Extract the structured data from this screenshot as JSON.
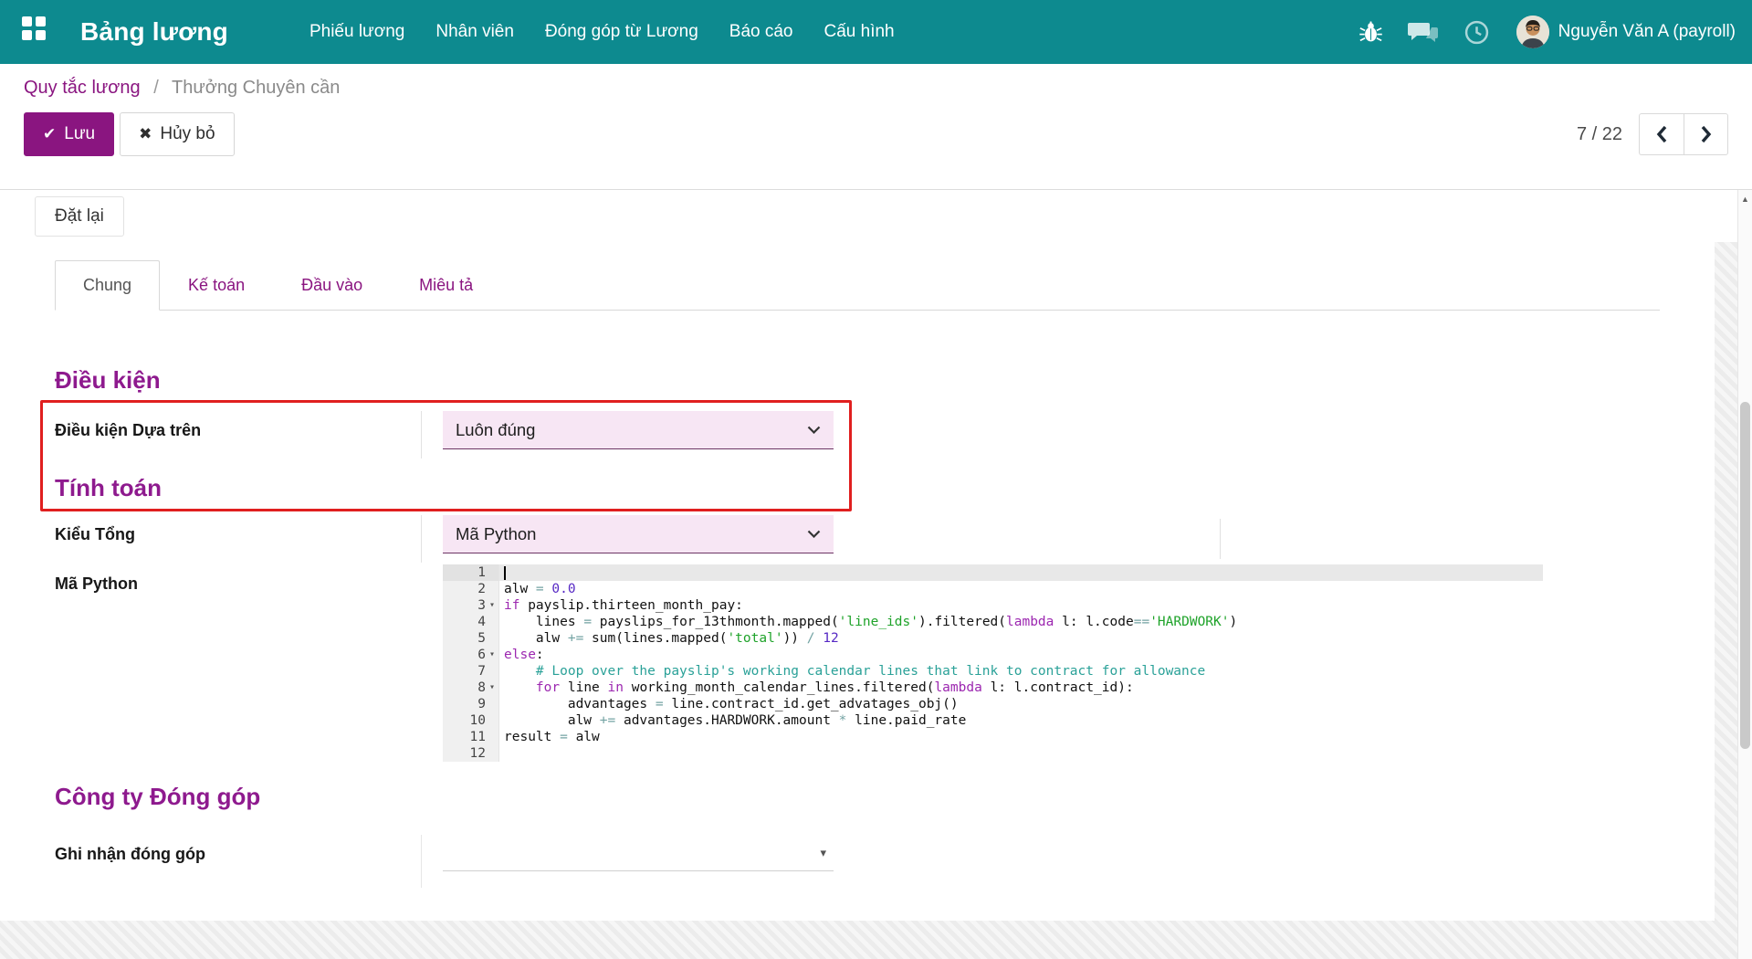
{
  "colors": {
    "navbar_bg": "#0d8a8f",
    "accent_purple": "#8a1580",
    "heading_purple": "#8e1a8e",
    "select_bg": "#f7e6f4",
    "annotation_red": "#e01f1f",
    "code_keyword": "#9c27b0",
    "code_number": "#5628c4",
    "code_string": "#1fa32a",
    "code_comment": "#2aa198",
    "code_operator": "#73a3a3"
  },
  "navbar": {
    "app_title": "Bảng lương",
    "menu_items": [
      {
        "label": "Phiếu lương"
      },
      {
        "label": "Nhân viên"
      },
      {
        "label": "Đóng góp từ Lương"
      },
      {
        "label": "Báo cáo"
      },
      {
        "label": "Cấu hình"
      }
    ],
    "user_name": "Nguyễn Văn A (payroll)"
  },
  "breadcrumb": {
    "parent": "Quy tắc lương",
    "separator": "/",
    "current": "Thưởng Chuyên cần"
  },
  "control_panel": {
    "save_label": "Lưu",
    "discard_label": "Hủy bỏ",
    "pager_value": "7 / 22"
  },
  "statusbar": {
    "reset_label": "Đặt lại"
  },
  "notebook": {
    "tabs": [
      {
        "label": "Chung",
        "active": true
      },
      {
        "label": "Kế toán",
        "active": false
      },
      {
        "label": "Đầu vào",
        "active": false
      },
      {
        "label": "Miêu tả",
        "active": false
      }
    ]
  },
  "form": {
    "condition_section": {
      "title": "Điều kiện",
      "condition_based_on_label": "Điều kiện Dựa trên",
      "condition_based_on_value": "Luôn đúng"
    },
    "computation_section": {
      "title": "Tính toán",
      "amount_type_label": "Kiểu Tổng",
      "amount_type_value": "Mã Python",
      "python_code_label": "Mã Python"
    },
    "contribution_section": {
      "title": "Công ty Đóng góp",
      "register_label": "Ghi nhận đóng góp",
      "register_value": ""
    }
  },
  "code_editor": {
    "lines": [
      {
        "number": 1,
        "fold": false,
        "active": true,
        "tokens": []
      },
      {
        "number": 2,
        "fold": false,
        "tokens": [
          {
            "t": "alw ",
            "c": "plain"
          },
          {
            "t": "=",
            "c": "op"
          },
          {
            "t": " ",
            "c": "plain"
          },
          {
            "t": "0.0",
            "c": "num"
          }
        ]
      },
      {
        "number": 3,
        "fold": true,
        "tokens": [
          {
            "t": "if",
            "c": "kw"
          },
          {
            "t": " payslip.thirteen_month_pay:",
            "c": "plain"
          }
        ]
      },
      {
        "number": 4,
        "fold": false,
        "tokens": [
          {
            "t": "    lines ",
            "c": "plain"
          },
          {
            "t": "=",
            "c": "op"
          },
          {
            "t": " payslips_for_13thmonth.mapped(",
            "c": "plain"
          },
          {
            "t": "'line_ids'",
            "c": "str"
          },
          {
            "t": ").filtered(",
            "c": "plain"
          },
          {
            "t": "lambda",
            "c": "kw"
          },
          {
            "t": " l: l.code",
            "c": "plain"
          },
          {
            "t": "==",
            "c": "op"
          },
          {
            "t": "'HARDWORK'",
            "c": "str"
          },
          {
            "t": ")",
            "c": "plain"
          }
        ]
      },
      {
        "number": 5,
        "fold": false,
        "tokens": [
          {
            "t": "    alw ",
            "c": "plain"
          },
          {
            "t": "+=",
            "c": "op"
          },
          {
            "t": " sum(lines.mapped(",
            "c": "plain"
          },
          {
            "t": "'total'",
            "c": "str"
          },
          {
            "t": ")) ",
            "c": "plain"
          },
          {
            "t": "/",
            "c": "op"
          },
          {
            "t": " ",
            "c": "plain"
          },
          {
            "t": "12",
            "c": "num"
          }
        ]
      },
      {
        "number": 6,
        "fold": true,
        "tokens": [
          {
            "t": "else",
            "c": "kw"
          },
          {
            "t": ":",
            "c": "plain"
          }
        ]
      },
      {
        "number": 7,
        "fold": false,
        "tokens": [
          {
            "t": "    # Loop over the payslip's working calendar lines that link to contract for allowance",
            "c": "com"
          }
        ]
      },
      {
        "number": 8,
        "fold": true,
        "tokens": [
          {
            "t": "    ",
            "c": "plain"
          },
          {
            "t": "for",
            "c": "kw"
          },
          {
            "t": " line ",
            "c": "plain"
          },
          {
            "t": "in",
            "c": "kw"
          },
          {
            "t": " working_month_calendar_lines.filtered(",
            "c": "plain"
          },
          {
            "t": "lambda",
            "c": "kw"
          },
          {
            "t": " l: l.contract_id):",
            "c": "plain"
          }
        ]
      },
      {
        "number": 9,
        "fold": false,
        "tokens": [
          {
            "t": "        advantages ",
            "c": "plain"
          },
          {
            "t": "=",
            "c": "op"
          },
          {
            "t": " line.contract_id.get_advatages_obj()",
            "c": "plain"
          }
        ]
      },
      {
        "number": 10,
        "fold": false,
        "tokens": [
          {
            "t": "        alw ",
            "c": "plain"
          },
          {
            "t": "+=",
            "c": "op"
          },
          {
            "t": " advantages.HARDWORK.amount ",
            "c": "plain"
          },
          {
            "t": "*",
            "c": "op"
          },
          {
            "t": " line.paid_rate",
            "c": "plain"
          }
        ]
      },
      {
        "number": 11,
        "fold": false,
        "tokens": [
          {
            "t": "result ",
            "c": "plain"
          },
          {
            "t": "=",
            "c": "op"
          },
          {
            "t": " alw",
            "c": "plain"
          }
        ]
      },
      {
        "number": 12,
        "fold": false,
        "tokens": []
      }
    ]
  },
  "scrollbar": {
    "up_arrow": "▲"
  }
}
